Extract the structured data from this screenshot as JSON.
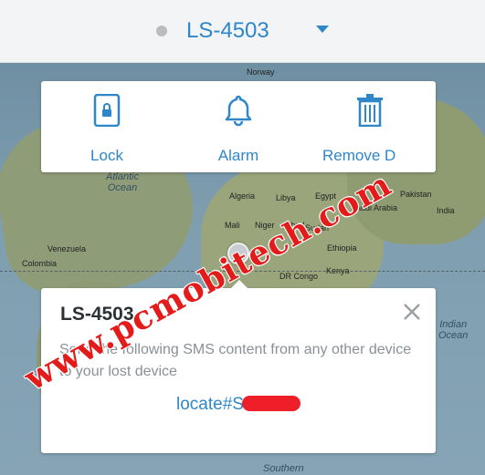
{
  "header": {
    "device_name": "LS-4503",
    "status_color": "#b9bdc0"
  },
  "actions": [
    {
      "label": "Lock",
      "icon": "lock-phone-icon"
    },
    {
      "label": "Alarm",
      "icon": "bell-icon"
    },
    {
      "label": "Remove D",
      "icon": "trash-icon"
    }
  ],
  "map": {
    "labels": {
      "norway": "Norway",
      "atlantic": "Atlantic",
      "ocean": "Ocean",
      "algeria": "Algeria",
      "libya": "Libya",
      "egypt": "Egypt",
      "mali": "Mali",
      "niger": "Niger",
      "chad": "Chad",
      "sudan": "Sudan",
      "ethiopia": "Ethiopia",
      "saudi": "Saudi Arabia",
      "pakistan": "Pakistan",
      "india": "India",
      "venezuela": "Venezuela",
      "colombia": "Colombia",
      "congo": "DR Congo",
      "kenya": "Kenya",
      "indian": "Indian",
      "ocean2": "Ocean",
      "southern": "Southern"
    }
  },
  "popup": {
    "title": "LS-4503",
    "message": "Send the following SMS content from any other device to your lost device",
    "sms_prefix": "locate#S"
  },
  "watermark": "www.pcmobitech.com",
  "colors": {
    "accent": "#2f86c8",
    "redaction": "#ee1f28",
    "watermark": "#e41b1b"
  }
}
